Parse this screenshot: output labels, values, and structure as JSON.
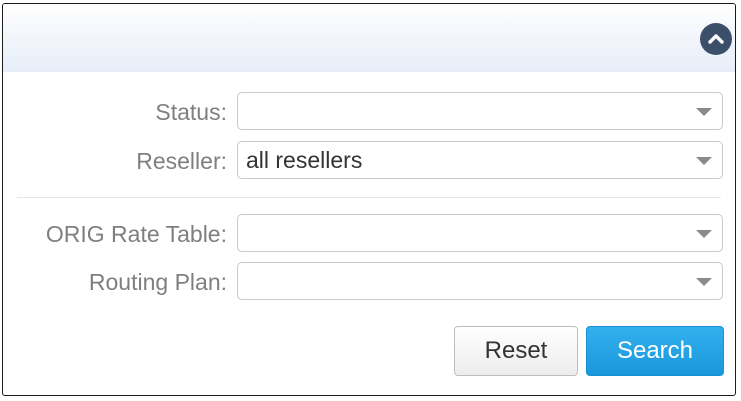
{
  "filter_panel": {
    "collapse_icon": "chevron-up-icon",
    "fields": {
      "status": {
        "label": "Status:",
        "value": ""
      },
      "reseller": {
        "label": "Reseller:",
        "value": "all resellers"
      },
      "orig_rate_table": {
        "label": "ORIG Rate Table:",
        "value": ""
      },
      "routing_plan": {
        "label": "Routing Plan:",
        "value": ""
      }
    },
    "buttons": {
      "reset_label": "Reset",
      "search_label": "Search"
    },
    "colors": {
      "search_button": "#1a97dc",
      "collapse_button": "#3b4f6b",
      "label_text": "#7f7f7f"
    }
  }
}
